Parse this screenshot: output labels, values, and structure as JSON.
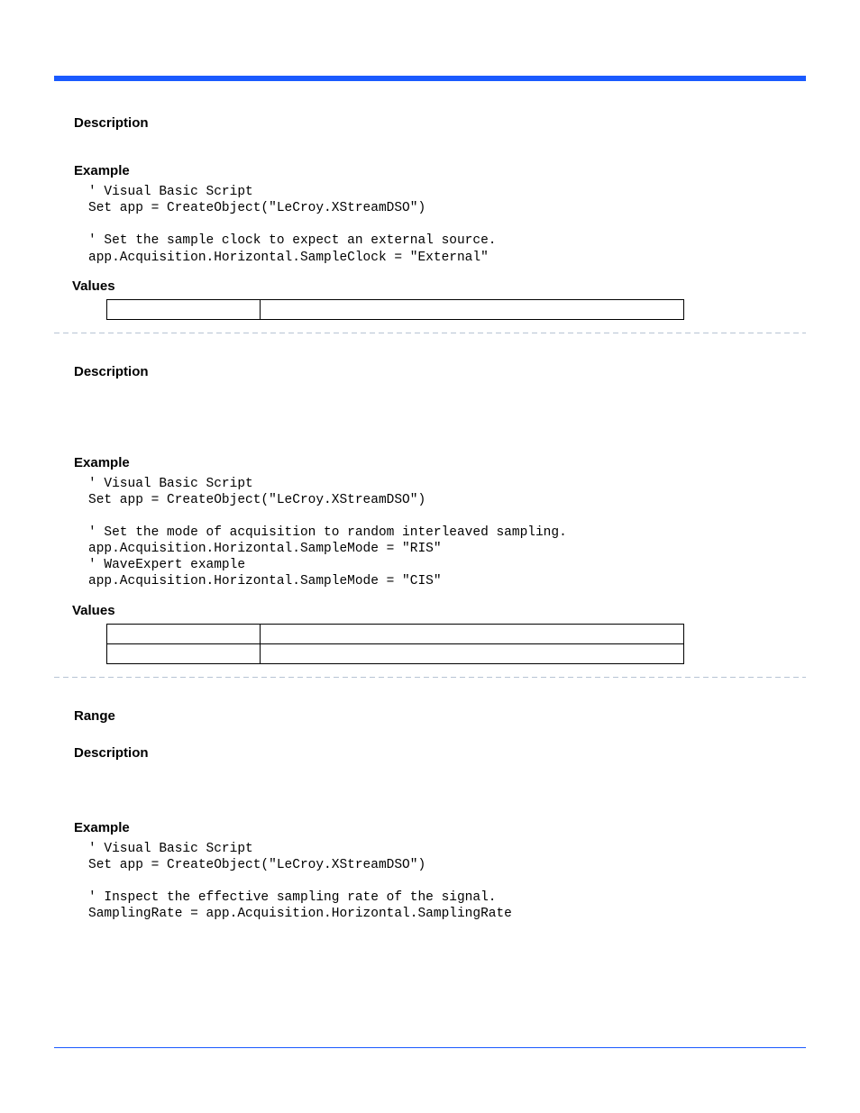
{
  "section1": {
    "h_desc": "Description",
    "h_example": "Example",
    "code": "' Visual Basic Script\nSet app = CreateObject(\"LeCroy.XStreamDSO\")\n\n' Set the sample clock to expect an external source.\napp.Acquisition.Horizontal.SampleClock = \"External\"",
    "h_values": "Values"
  },
  "section2": {
    "h_desc": "Description",
    "h_example": "Example",
    "code": "' Visual Basic Script\nSet app = CreateObject(\"LeCroy.XStreamDSO\")\n\n' Set the mode of acquisition to random interleaved sampling.\napp.Acquisition.Horizontal.SampleMode = \"RIS\"\n' WaveExpert example\napp.Acquisition.Horizontal.SampleMode = \"CIS\"",
    "h_values": "Values"
  },
  "section3": {
    "h_range": "Range",
    "h_desc": "Description",
    "h_example": "Example",
    "code": "' Visual Basic Script\nSet app = CreateObject(\"LeCroy.XStreamDSO\")\n\n' Inspect the effective sampling rate of the signal.\nSamplingRate = app.Acquisition.Horizontal.SamplingRate"
  }
}
